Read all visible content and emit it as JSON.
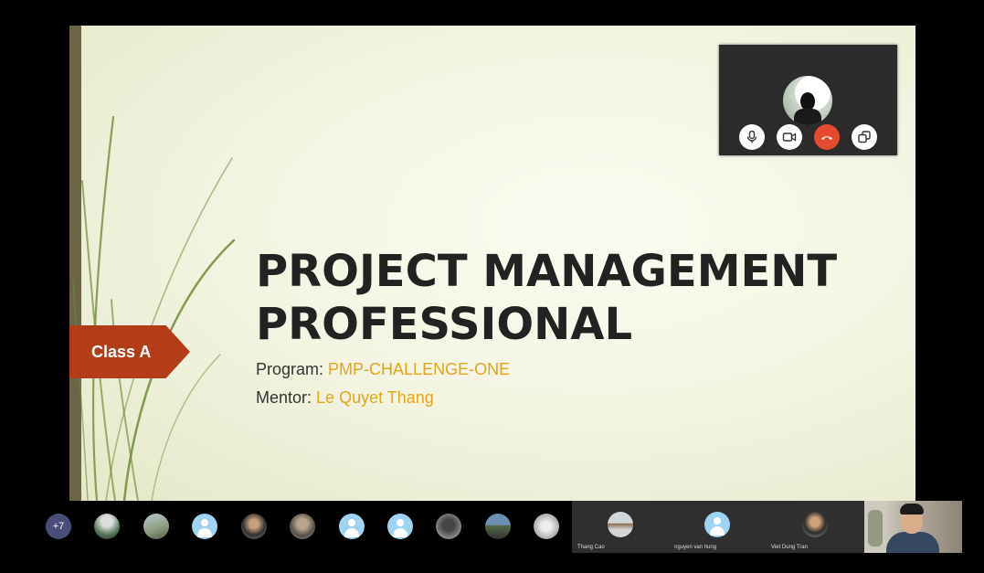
{
  "slide": {
    "tag": "Class A",
    "title_line1": "PROJECT MANAGEMENT",
    "title_line2": "PROFESSIONAL",
    "program_label": "Program:",
    "program_value": "PMP-CHALLENGE-ONE",
    "mentor_label": "Mentor:",
    "mentor_value": "Le Quyet Thang",
    "colors": {
      "tag": "#b33d16",
      "accent_text": "#e3a51b",
      "title": "#222222"
    }
  },
  "self_video": {
    "controls": [
      {
        "name": "microphone",
        "icon": "mic-icon"
      },
      {
        "name": "camera",
        "icon": "video-camera-icon"
      },
      {
        "name": "hang-up",
        "icon": "phone-hangup-icon",
        "color": "#e5492f"
      },
      {
        "name": "switch-view",
        "icon": "window-swap-icon"
      }
    ]
  },
  "participants": {
    "more_count": "+7",
    "tiles": [
      {
        "name": "Thang Cao"
      },
      {
        "name": "nguyen van hung"
      },
      {
        "name": "Viet Dung Tran"
      }
    ]
  }
}
